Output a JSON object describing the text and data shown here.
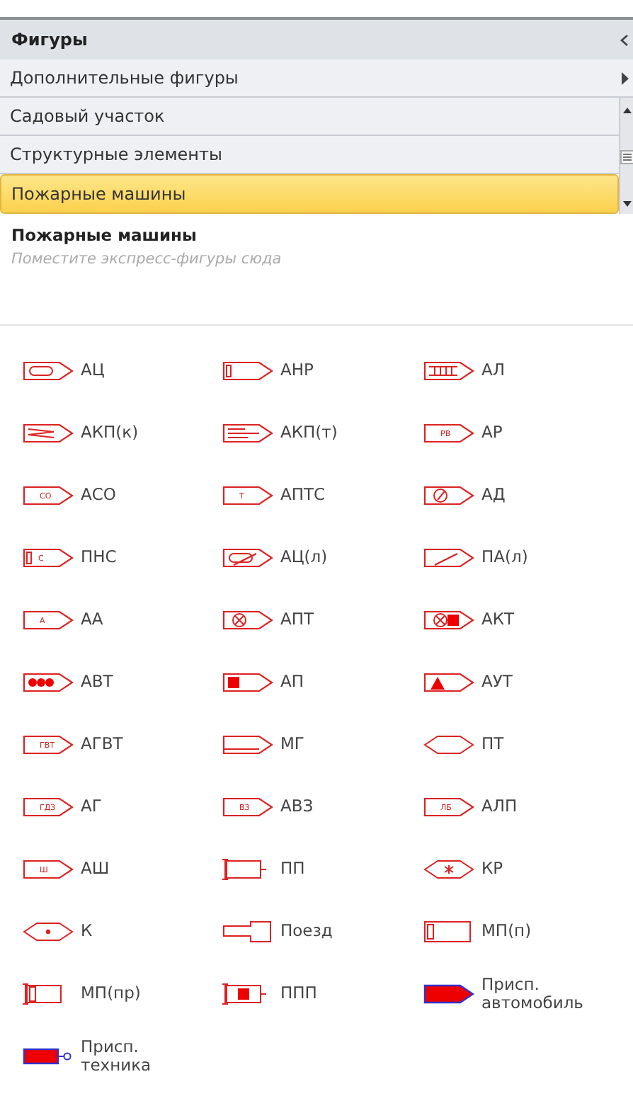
{
  "panel": {
    "title": "Фигуры"
  },
  "stencils": [
    {
      "label": "Дополнительные фигуры",
      "kind": "submenu",
      "selected": false
    },
    {
      "label": "Садовый участок",
      "kind": "stencil",
      "selected": false
    },
    {
      "label": "Структурные элементы",
      "kind": "stencil",
      "selected": false
    },
    {
      "label": "Пожарные машины",
      "kind": "stencil",
      "selected": true
    }
  ],
  "stencil_header": {
    "title": "Пожарные машины",
    "placeholder": "Поместите экспресс-фигуры сюда"
  },
  "shapes": [
    {
      "label": "АЦ",
      "kind": "oval"
    },
    {
      "label": "АНР",
      "kind": "bar"
    },
    {
      "label": "АЛ",
      "kind": "ladder"
    },
    {
      "label": "АКП(к)",
      "kind": "zigzag"
    },
    {
      "label": "АКП(т)",
      "kind": "lines"
    },
    {
      "label": "АР",
      "kind": "mark",
      "mark": "РВ"
    },
    {
      "label": "АСО",
      "kind": "mark",
      "mark": "СО"
    },
    {
      "label": "АПТС",
      "kind": "mark",
      "mark": "Т"
    },
    {
      "label": "АД",
      "kind": "gauge"
    },
    {
      "label": "ПНС",
      "kind": "bar-mark",
      "mark": "С"
    },
    {
      "label": "АЦ(л)",
      "kind": "oval-lift"
    },
    {
      "label": "ПА(л)",
      "kind": "lift"
    },
    {
      "label": "АА",
      "kind": "mark",
      "mark": "А"
    },
    {
      "label": "АПТ",
      "kind": "cross"
    },
    {
      "label": "АКТ",
      "kind": "cross-square"
    },
    {
      "label": "АВТ",
      "kind": "dots"
    },
    {
      "label": "АП",
      "kind": "square"
    },
    {
      "label": "АУТ",
      "kind": "triangle"
    },
    {
      "label": "АГВТ",
      "kind": "mark",
      "mark": "ГВТ"
    },
    {
      "label": "МГ",
      "kind": "double"
    },
    {
      "label": "ПТ",
      "kind": "diamond"
    },
    {
      "label": "АГ",
      "kind": "mark",
      "mark": "ГДЗ"
    },
    {
      "label": "АВЗ",
      "kind": "mark",
      "mark": "ВЗ"
    },
    {
      "label": "АЛП",
      "kind": "mark",
      "mark": "ЛБ"
    },
    {
      "label": "АШ",
      "kind": "mark",
      "mark": "Ш"
    },
    {
      "label": "ПП",
      "kind": "pump"
    },
    {
      "label": "КР",
      "kind": "diamond-dots"
    },
    {
      "label": "К",
      "kind": "diamond-dot"
    },
    {
      "label": "Поезд",
      "kind": "train"
    },
    {
      "label": "МП(п)",
      "kind": "box"
    },
    {
      "label": "МП(пр)",
      "kind": "box-pump"
    },
    {
      "label": "ППП",
      "kind": "pump-square"
    },
    {
      "label": "Присп. автомобиль",
      "kind": "trailer-car"
    },
    {
      "label": "Присп. техника",
      "kind": "trailer-tech"
    }
  ]
}
